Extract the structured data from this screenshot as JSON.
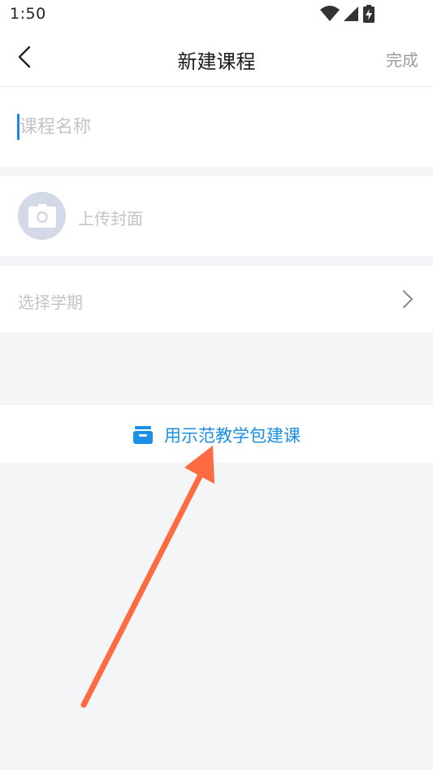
{
  "status_bar": {
    "time": "1:50"
  },
  "nav": {
    "title": "新建课程",
    "done_label": "完成"
  },
  "form": {
    "course_name": {
      "value": "",
      "placeholder": "课程名称"
    },
    "cover": {
      "label": "上传封面"
    },
    "term": {
      "label": "选择学期"
    }
  },
  "template": {
    "label": "用示范教学包建课"
  },
  "colors": {
    "accent": "#1a8fe3",
    "placeholder": "#c4c4c4",
    "annotation_arrow": "#ff6b40",
    "background": "#f4f5f7"
  },
  "icons": {
    "back": "chevron-left-icon",
    "camera": "camera-icon",
    "term_chevron": "chevron-right-icon",
    "template": "package-box-icon",
    "wifi": "wifi-icon",
    "signal": "signal-icon",
    "battery": "battery-charging-icon"
  }
}
